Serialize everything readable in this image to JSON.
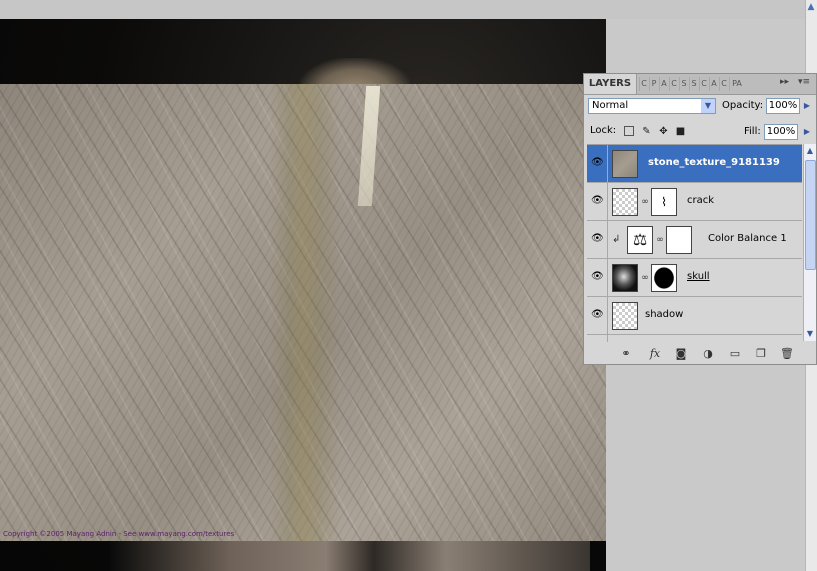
{
  "canvas": {
    "copyright": "Copyright ©2005 Mayang Adnin - See www.mayang.com/textures"
  },
  "layers_panel": {
    "tabs": {
      "active": "LAYERS",
      "collapsed": [
        "C",
        "P",
        "A",
        "C",
        "S",
        "S",
        "C",
        "A",
        "C",
        "PA"
      ]
    },
    "menu_buttons": [
      "▸▸",
      "▾≡"
    ],
    "blend_mode": "Normal",
    "opacity_label": "Opacity:",
    "opacity_value": "100%",
    "lock_label": "Lock:",
    "fill_label": "Fill:",
    "fill_value": "100%",
    "layers": [
      {
        "name": "stone_texture_9181139",
        "selected": true,
        "visible": true
      },
      {
        "name": "crack",
        "selected": false,
        "visible": true
      },
      {
        "name": "Color Balance 1",
        "selected": false,
        "visible": true
      },
      {
        "name": "skull",
        "selected": false,
        "visible": true
      },
      {
        "name": "shadow",
        "selected": false,
        "visible": true
      }
    ],
    "footer_icons": [
      "link-layers-icon",
      "fx-icon",
      "add-mask-icon",
      "adjustment-layer-icon",
      "new-group-icon",
      "new-layer-icon",
      "delete-layer-icon"
    ],
    "fx_label": "fx"
  },
  "colors": {
    "selection": "#3a6ebf",
    "panel_bg": "#d6d6d6",
    "copyright_text": "#5b1c6b"
  }
}
